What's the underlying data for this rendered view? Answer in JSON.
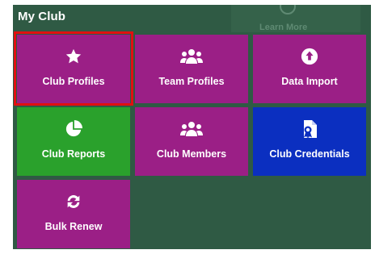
{
  "panel": {
    "title": "My Club",
    "background_link_label": "Learn More"
  },
  "tiles": [
    {
      "label": "Club Profiles",
      "icon": "star-icon",
      "color": "#9b1f86",
      "selected": true
    },
    {
      "label": "Team Profiles",
      "icon": "users-icon",
      "color": "#9b1f86"
    },
    {
      "label": "Data Import",
      "icon": "upload-icon",
      "color": "#9b1f86"
    },
    {
      "label": "Club Reports",
      "icon": "pie-chart-icon",
      "color": "#2aa12c"
    },
    {
      "label": "Club Members",
      "icon": "users-icon",
      "color": "#9b1f86"
    },
    {
      "label": "Club Credentials",
      "icon": "certificate-icon",
      "color": "#0b2fc0"
    },
    {
      "label": "Bulk Renew",
      "icon": "refresh-icon",
      "color": "#9b1f86"
    }
  ],
  "colors": {
    "panel_background": "#2f5a44",
    "selection_outline": "#e11010"
  }
}
